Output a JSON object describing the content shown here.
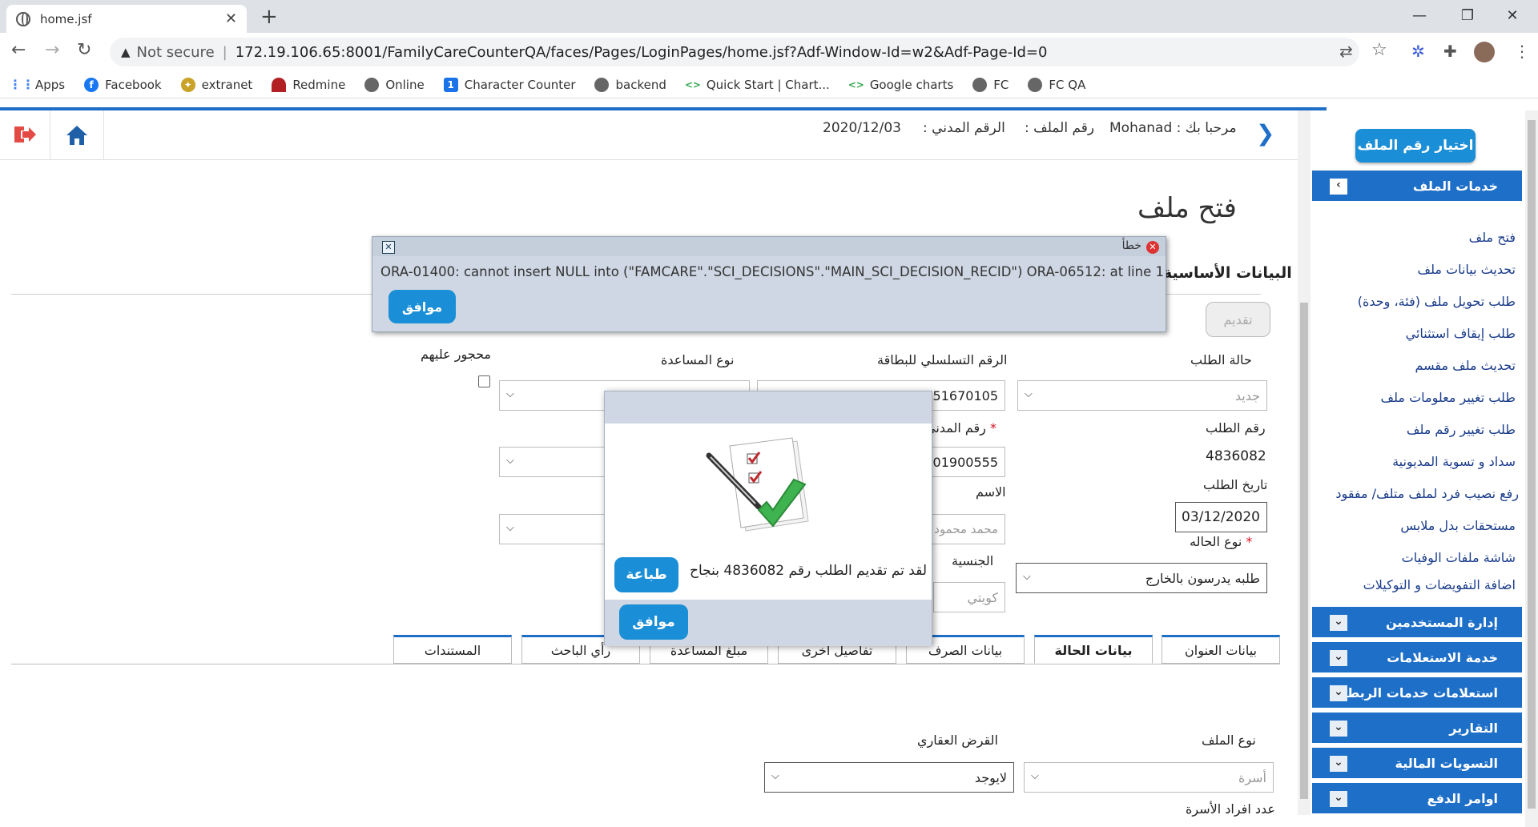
{
  "browser": {
    "tab_title": "home.jsf",
    "security_label": "Not secure",
    "url": "172.19.106.65:8001/FamilyCareCounterQA/faces/Pages/LoginPages/home.jsf?Adf-Window-Id=w2&Adf-Page-Id=0",
    "bookmarks": [
      "Apps",
      "Facebook",
      "extranet",
      "Redmine",
      "Online",
      "Character Counter",
      "backend",
      "Quick Start | Chart...",
      "Google charts",
      "FC",
      "FC QA"
    ]
  },
  "header": {
    "welcome": "مرحبا بك : Mohanad",
    "file_number_label": "رقم الملف :",
    "civil_id_label": "الرقم المدني :",
    "date": "2020/12/03"
  },
  "sidebar": {
    "pick_file_button": "اختيار رقم الملف",
    "file_services": "خدمات الملف",
    "links": [
      "فتح ملف",
      "تحديث بيانات ملف",
      "طلب تحويل ملف (فئة، وحدة)",
      "طلب إيقاف استثنائي",
      "تحديث ملف مقسم",
      "طلب تغيير معلومات ملف",
      "طلب تغيير رقم ملف",
      "سداد و تسوية المديونية",
      "رفع نصيب فرد لملف متلف/ مفقود",
      "مستحقات بدل ملابس",
      "شاشة ملفات الوفيات",
      "اضافة التفويضات و التوكيلات"
    ],
    "sections": [
      "إدارة المستخدمين",
      "خدمة الاستعلامات",
      "استعلامات خدمات الربط",
      "التقارير",
      "التسويات المالية",
      "اوامر الدفع"
    ]
  },
  "page": {
    "title": "فتح ملف",
    "section_basic": "البيانات الأساسية",
    "submit": "تقديم",
    "labels": {
      "request_status": "حالة الطلب",
      "card_serial": "الرقم التسلسلي للبطاقة",
      "aid_type": "نوع المساعدة",
      "restricted": "محجور عليهم",
      "request_number": "رقم الطلب",
      "civil_id": "رقم المدني",
      "request_date": "تاريخ الطلب",
      "name": "الاسم",
      "case_type": "نوع الحاله",
      "nationality": "الجنسية",
      "file_type": "نوع الملف",
      "housing_loan": "القرض العقاري",
      "family_members": "عدد افراد الأسرة"
    },
    "values": {
      "request_status": "جديد",
      "card_serial": "051670105",
      "request_number": "4836082",
      "civil_id": "101900555",
      "request_date": "03/12/2020",
      "name": "محمد محمود",
      "case_type": "طلبه يدرسون بالخارج",
      "nationality": "كويتي",
      "file_type": "أسرة",
      "housing_loan": "لايوجد"
    },
    "tabs": [
      "بيانات العنوان",
      "بيانات الحالة",
      "بيانات الصرف",
      "تفاصيل اخرى",
      "مبلغ المساعدة",
      "رأي الباحث",
      "المستندات"
    ]
  },
  "error_popup": {
    "title": "خطأ",
    "message": "ORA-01400: cannot insert NULL into (\"FAMCARE\".\"SCI_DECISIONS\".\"MAIN_SCI_DECISION_RECID\") ORA-06512: at line 1",
    "ok": "موافق"
  },
  "success_popup": {
    "message": "لقد تم تقديم الطلب رقم  4836082  بنجاح",
    "print": "طباعة",
    "ok": "موافق"
  },
  "colors": {
    "accent": "#1e6fc8",
    "button": "#1a8ed6",
    "popup_bg": "#ced7e3"
  }
}
